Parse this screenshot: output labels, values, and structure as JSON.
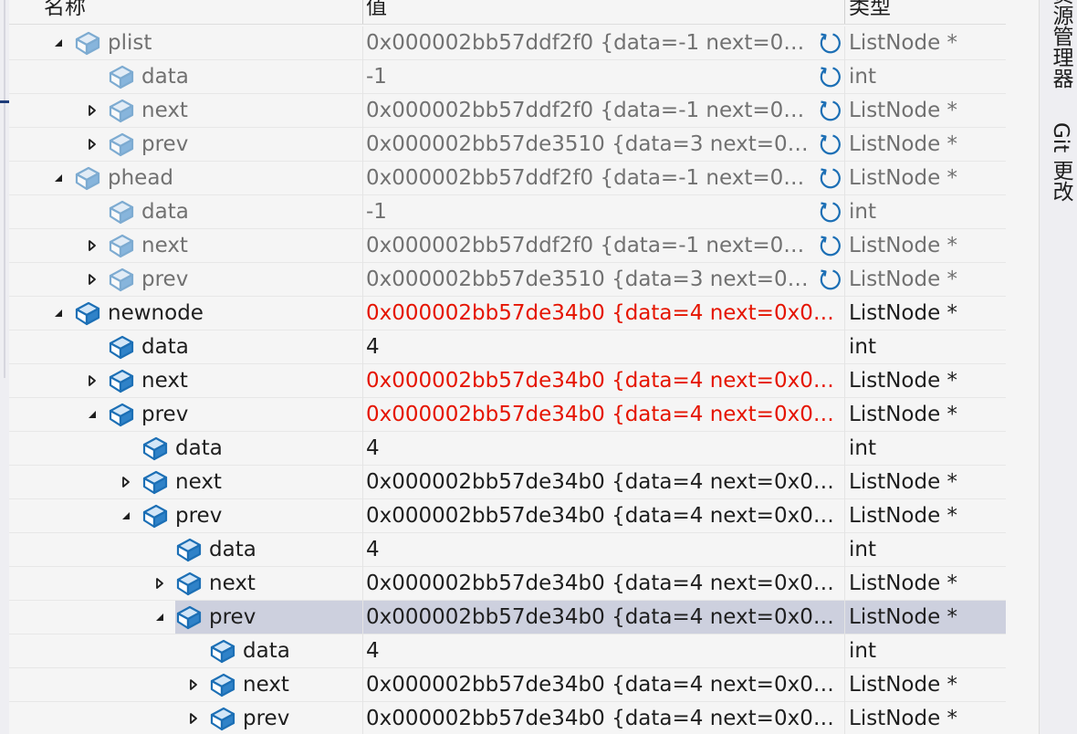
{
  "columns": {
    "name": "名称",
    "value": "值",
    "type": "类型"
  },
  "side_tabs": [
    "资源管理器",
    "Git 更改"
  ],
  "colors": {
    "changed_value": "#e51400",
    "stale_text": "#717171",
    "selection": "#cdd0de",
    "icon_blue": "#1c6fb5"
  },
  "rows": [
    {
      "level": 0,
      "expander": "expanded",
      "name": "plist",
      "value": "0x000002bb57ddf2f0 {data=-1 next=0x0...",
      "type": "ListNode *",
      "stale": true,
      "refresh_icon": true
    },
    {
      "level": 1,
      "expander": "none",
      "name": "data",
      "value": "-1",
      "type": "int",
      "stale": true,
      "refresh_icon": true
    },
    {
      "level": 1,
      "expander": "collapsed",
      "name": "next",
      "value": "0x000002bb57ddf2f0 {data=-1 next=0x0...",
      "type": "ListNode *",
      "stale": true,
      "refresh_icon": true
    },
    {
      "level": 1,
      "expander": "collapsed",
      "name": "prev",
      "value": "0x000002bb57de3510 {data=3 next=0x0...",
      "type": "ListNode *",
      "stale": true,
      "refresh_icon": true
    },
    {
      "level": 0,
      "expander": "expanded",
      "name": "phead",
      "value": "0x000002bb57ddf2f0 {data=-1 next=0x0...",
      "type": "ListNode *",
      "stale": true,
      "refresh_icon": true
    },
    {
      "level": 1,
      "expander": "none",
      "name": "data",
      "value": "-1",
      "type": "int",
      "stale": true,
      "refresh_icon": true
    },
    {
      "level": 1,
      "expander": "collapsed",
      "name": "next",
      "value": "0x000002bb57ddf2f0 {data=-1 next=0x0...",
      "type": "ListNode *",
      "stale": true,
      "refresh_icon": true
    },
    {
      "level": 1,
      "expander": "collapsed",
      "name": "prev",
      "value": "0x000002bb57de3510 {data=3 next=0x0...",
      "type": "ListNode *",
      "stale": true,
      "refresh_icon": true
    },
    {
      "level": 0,
      "expander": "expanded",
      "name": "newnode",
      "value": "0x000002bb57de34b0 {data=4 next=0x000...",
      "type": "ListNode *",
      "changed": true
    },
    {
      "level": 1,
      "expander": "none",
      "name": "data",
      "value": "4",
      "type": "int"
    },
    {
      "level": 1,
      "expander": "collapsed",
      "name": "next",
      "value": "0x000002bb57de34b0 {data=4 next=0x000...",
      "type": "ListNode *",
      "changed": true
    },
    {
      "level": 1,
      "expander": "expanded",
      "name": "prev",
      "value": "0x000002bb57de34b0 {data=4 next=0x000...",
      "type": "ListNode *",
      "changed": true
    },
    {
      "level": 2,
      "expander": "none",
      "name": "data",
      "value": "4",
      "type": "int"
    },
    {
      "level": 2,
      "expander": "collapsed",
      "name": "next",
      "value": "0x000002bb57de34b0 {data=4 next=0x000...",
      "type": "ListNode *"
    },
    {
      "level": 2,
      "expander": "expanded",
      "name": "prev",
      "value": "0x000002bb57de34b0 {data=4 next=0x000...",
      "type": "ListNode *"
    },
    {
      "level": 3,
      "expander": "none",
      "name": "data",
      "value": "4",
      "type": "int"
    },
    {
      "level": 3,
      "expander": "collapsed",
      "name": "next",
      "value": "0x000002bb57de34b0 {data=4 next=0x000...",
      "type": "ListNode *"
    },
    {
      "level": 3,
      "expander": "expanded",
      "name": "prev",
      "value": "0x000002bb57de34b0 {data=4 next=0x000...",
      "type": "ListNode *",
      "selected": true
    },
    {
      "level": 4,
      "expander": "none",
      "name": "data",
      "value": "4",
      "type": "int"
    },
    {
      "level": 4,
      "expander": "collapsed",
      "name": "next",
      "value": "0x000002bb57de34b0 {data=4 next=0x000...",
      "type": "ListNode *"
    },
    {
      "level": 4,
      "expander": "collapsed",
      "name": "prev",
      "value": "0x000002bb57de34b0 {data=4 next=0x000...",
      "type": "ListNode *"
    }
  ]
}
